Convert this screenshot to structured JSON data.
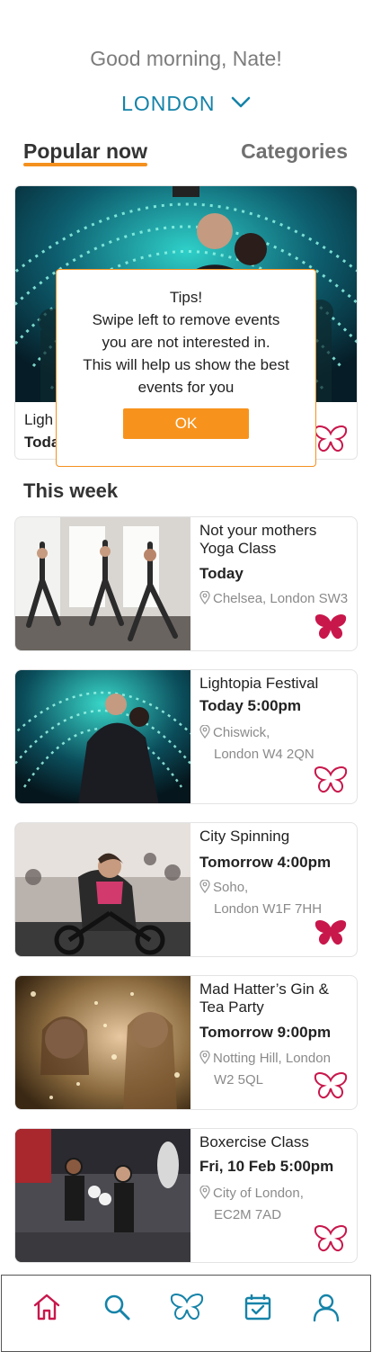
{
  "header": {
    "greeting": "Good morning, Nate!",
    "city": "LONDON"
  },
  "tabs": {
    "popular": "Popular now",
    "categories": "Categories"
  },
  "featured": {
    "title": "Lightopia Festival",
    "date": "Today 5:00pm",
    "title_visible": "Ligh",
    "date_visible": "Toda",
    "favorited": false
  },
  "tips_modal": {
    "heading": "Tips!",
    "lines": [
      "Swipe left to remove events",
      "you are not interested in.",
      "This will help us show the best",
      "events for you"
    ],
    "ok_label": "OK"
  },
  "this_week": {
    "title": "This week",
    "events": [
      {
        "title": "Not your mothers Yoga Class",
        "date": "Today",
        "location_line1": "Chelsea, London SW3",
        "location_line2": "",
        "favorited": true,
        "image": "yoga-class-photo"
      },
      {
        "title": "Lightopia Festival",
        "date": "Today 5:00pm",
        "location_line1": "Chiswick,",
        "location_line2": "London W4 2QN",
        "favorited": false,
        "image": "light-festival-photo"
      },
      {
        "title": "City Spinning",
        "date": "Tomorrow 4:00pm",
        "location_line1": "Soho,",
        "location_line2": "London W1F 7HH",
        "favorited": true,
        "image": "spinning-class-photo"
      },
      {
        "title": "Mad Hatter’s Gin & Tea Party",
        "date": "Tomorrow 9:00pm",
        "location_line1": "Notting Hill, London",
        "location_line2": "W2 5QL",
        "favorited": false,
        "image": "party-photo"
      },
      {
        "title": "Boxercise Class",
        "date": "Fri, 10 Feb 5:00pm",
        "location_line1": "City of London,",
        "location_line2": "EC2M 7AD",
        "favorited": false,
        "image": "boxercise-photo"
      }
    ]
  },
  "tab_bar": {
    "items": [
      "home-icon",
      "search-icon",
      "butterfly-icon",
      "calendar-icon",
      "profile-icon"
    ],
    "active": "home-icon"
  },
  "colors": {
    "accent_orange": "#f7931d",
    "brand_blue": "#1583a8",
    "favorite_red": "#c8174b"
  }
}
